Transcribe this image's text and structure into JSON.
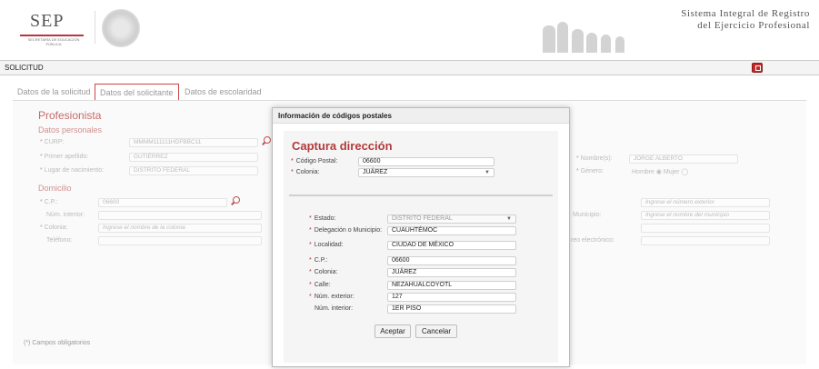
{
  "header": {
    "logo_text": "SEP",
    "logo_subtitle": "Secretaría de Educación Pública",
    "system_title_line1": "Sistema Integral de Registro",
    "system_title_line2": "del Ejercicio Profesional"
  },
  "solicitud_bar": {
    "label": "SOLICITUD"
  },
  "tabs": [
    {
      "label": "Datos de la solicitud"
    },
    {
      "label": "Datos del solicitante"
    },
    {
      "label": "Datos de escolaridad"
    }
  ],
  "background_form": {
    "section_title": "Profesionista",
    "personal_subtitle": "Datos personales",
    "curp_label": "CURP:",
    "curp_value": "MMMM111111HDFBBC11",
    "primer_apellido_label": "Primer apellido:",
    "primer_apellido_value": "GUTIÉRREZ",
    "lugar_nacimiento_label": "Lugar de nacimiento:",
    "lugar_nacimiento_value": "DISTRITO FEDERAL",
    "nombre_label": "Nombre(s):",
    "nombre_value": "JORGE ALBERTO",
    "genero_label": "Género:",
    "genero_value": "Hombre ◉ Mujer ◯",
    "domicilio_subtitle": "Domicilio",
    "cp_label": "C.P.:",
    "cp_value": "06600",
    "num_interior_label": "Núm. interior:",
    "colonia_label": "Colonia:",
    "colonia_placeholder": "Ingrese el nombre de la colonia",
    "telefono_label": "Teléfono:",
    "exterior_placeholder": "Ingrese el número exterior",
    "municipio_label": "Municipio:",
    "municipio_placeholder": "Ingrese el nombre del municipio",
    "correo_label": "reo electrónico:"
  },
  "modal": {
    "title": "Información de códigos postales",
    "capture_title": "Captura dirección",
    "top": {
      "cp_label": "Código Postal:",
      "cp_value": "06600",
      "colonia_label": "Colonia:",
      "colonia_value": "JUÁREZ"
    },
    "fields": [
      {
        "label": "Estado:",
        "value": "DISTRITO FEDERAL",
        "required": true,
        "disabled": true
      },
      {
        "label": "Delegación o Municipio:",
        "value": "CUAUHTÉMOC",
        "required": true,
        "disabled": false
      },
      {
        "label": "Localidad:",
        "value": "CIUDAD DE MÉXICO",
        "required": true,
        "disabled": false
      },
      {
        "label": "C.P.:",
        "value": "06600",
        "required": true,
        "disabled": false
      },
      {
        "label": "Colonia:",
        "value": "JUÁREZ",
        "required": true,
        "disabled": false
      },
      {
        "label": "Calle:",
        "value": "NEZAHUALCOYOTL",
        "required": true,
        "disabled": false
      },
      {
        "label": "Núm. exterior:",
        "value": "127",
        "required": true,
        "disabled": false
      },
      {
        "label": "Núm. interior:",
        "value": "1ER PISO",
        "required": false,
        "disabled": false
      }
    ],
    "accept_label": "Aceptar",
    "cancel_label": "Cancelar"
  },
  "footnote": "(*) Campos obligatorios",
  "colors": {
    "accent": "#b23b3b",
    "home_icon": "#c62828"
  }
}
